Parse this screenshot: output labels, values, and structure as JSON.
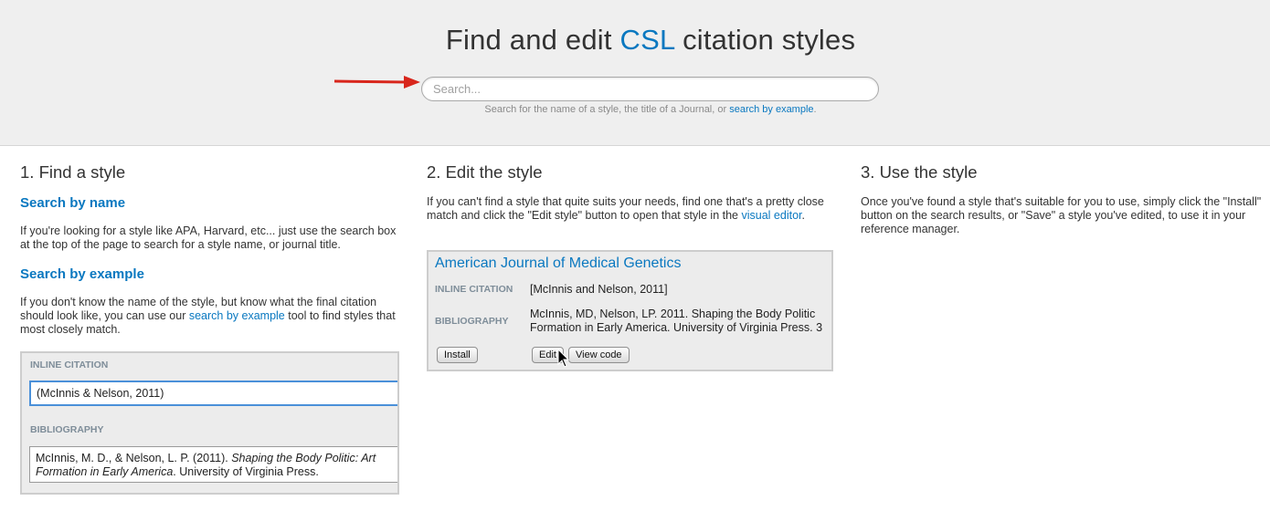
{
  "hero": {
    "title_before": "Find and edit ",
    "title_accent": "CSL",
    "title_after": " citation styles",
    "search_placeholder": "Search...",
    "hint_before": "Search for the name of a style, the title of a Journal, or ",
    "hint_link": "search by example",
    "hint_after": "."
  },
  "col1": {
    "heading": "1. Find a style",
    "by_name_heading": "Search by name",
    "by_name_text": "If you're looking for a style like APA, Harvard, etc... just use the search box at the top of the page to search for a style name, or journal title.",
    "by_example_heading": "Search by example",
    "by_example_before": "If you don't know the name of the style, but know what the final citation should look like, you can use our ",
    "by_example_link": "search by example",
    "by_example_after": " tool to find styles that most closely match.",
    "example": {
      "inline_label": "INLINE CITATION",
      "inline_value": "(McInnis & Nelson, 2011)",
      "bib_label": "BIBLIOGRAPHY",
      "bib_part1": "McInnis, M. D., & Nelson, L. P. (2011). ",
      "bib_italic": "Shaping the Body Politic: Art Formation in Early America",
      "bib_part2": ". University of Virginia Press."
    }
  },
  "col2": {
    "heading": "2. Edit the style",
    "text_before": "If you can't find a style that quite suits your needs, find one that's a pretty close match and click the \"Edit style\" button to open that style in the ",
    "text_link": "visual editor",
    "text_after": ".",
    "result": {
      "title": "American Journal of Medical Genetics",
      "inline_label": "INLINE CITATION",
      "inline_value": "[McInnis and Nelson, 2011]",
      "bib_label": "BIBLIOGRAPHY",
      "bib_line1": "McInnis, MD, Nelson, LP. 2011. Shaping the Body Politic",
      "bib_line2": "Formation in Early America. University of Virginia Press. 3",
      "install_label": "Install",
      "edit_label": "Edit",
      "view_code_label": "View code"
    }
  },
  "col3": {
    "heading": "3. Use the style",
    "text": "Once you've found a style that's suitable for you to use, simply click the \"Install\" button on the search results, or \"Save\" a style you've edited, to use it in your reference manager."
  },
  "colors": {
    "accent": "#0a78c0",
    "arrow": "#d8261c",
    "hero_bg": "#efefef"
  }
}
